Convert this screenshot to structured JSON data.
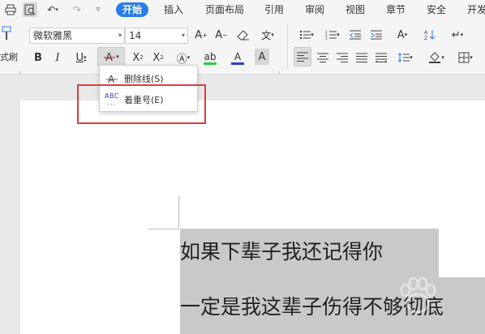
{
  "menubar": {
    "tabs": [
      "开始",
      "插入",
      "页面布局",
      "引用",
      "审阅",
      "视图",
      "章节",
      "安全",
      "开发"
    ],
    "active_tab": "开始"
  },
  "ribbon": {
    "format_painter_label": "式刷",
    "font_name": "微软雅黑",
    "font_size": "14"
  },
  "dropdown": {
    "items": [
      {
        "label": "删除线(S)",
        "icon": "strikethrough-icon"
      },
      {
        "label": "着重号(E)",
        "icon": "emphasis-mark-icon",
        "icon_text": "ABC"
      }
    ]
  },
  "document": {
    "lines": [
      "如果下辈子我还记得你",
      "一定是我这辈子伤得不够彻底"
    ]
  },
  "colors": {
    "accent": "#2b7de9",
    "highlight_box": "#e23a3a",
    "selection": "#c9c9c9",
    "font_color_underline": "#2b3bd6",
    "highlight_underline": "#2ecc40",
    "strike_icon": "#d33"
  }
}
